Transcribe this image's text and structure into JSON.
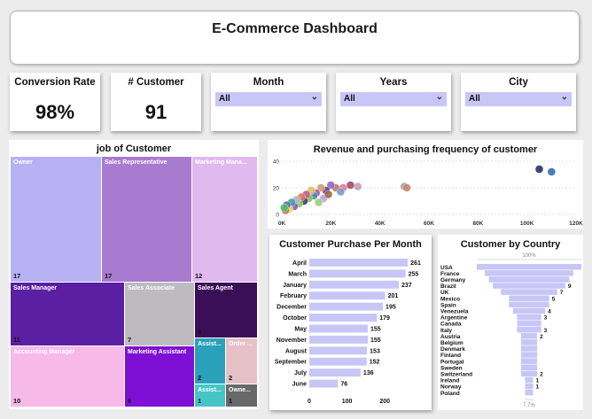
{
  "header": {
    "title": "E-Commerce Dashboard"
  },
  "kpis": [
    {
      "label": "Conversion Rate",
      "value": "98%"
    },
    {
      "label": "# Customer",
      "value": "91"
    }
  ],
  "slicers": [
    {
      "label": "Month",
      "value": "All"
    },
    {
      "label": "Years",
      "value": "All"
    },
    {
      "label": "City",
      "value": "All"
    }
  ],
  "treemap": {
    "title": "job of Customer",
    "cells": [
      {
        "name": "Owner",
        "count": "17",
        "color": "#b7b0f2"
      },
      {
        "name": "Sales Representative",
        "count": "17",
        "color": "#a87ad0"
      },
      {
        "name": "Marketing Mana...",
        "count": "12",
        "color": "#e0b9ee"
      },
      {
        "name": "Sales Manager",
        "count": "11",
        "color": "#5a1fa3"
      },
      {
        "name": "Sales Associate",
        "count": "7",
        "color": "#bdbac0"
      },
      {
        "name": "Sales Agent",
        "count": "6",
        "color": "#3a0f57"
      },
      {
        "name": "Accounting Manager",
        "count": "10",
        "color": "#f6b9e8"
      },
      {
        "name": "Marketing Assistant",
        "count": "6",
        "color": "#7d10d4"
      },
      {
        "name": "Assist...",
        "count": "2",
        "color": "#2aa0ba"
      },
      {
        "name": "Order ...",
        "count": "2",
        "color": "#e5c0c7"
      },
      {
        "name": "Assist...",
        "count": "1",
        "color": "#46c5c7"
      },
      {
        "name": "Owne...",
        "count": "1",
        "color": "#686868"
      }
    ]
  },
  "chart_data": [
    {
      "type": "scatter",
      "title": "Revenue and purchasing frequency of customer",
      "xlabel": "",
      "ylabel": "",
      "xlim": [
        0,
        120000
      ],
      "ylim": [
        0,
        40
      ],
      "x_ticks": [
        "0K",
        "20K",
        "40K",
        "60K",
        "80K",
        "100K",
        "120K"
      ],
      "y_ticks": [
        "0",
        "20",
        "40"
      ],
      "points": [
        {
          "x": 105000,
          "y": 34,
          "color": "#2b2f6b"
        },
        {
          "x": 110000,
          "y": 32,
          "color": "#3a6fb0"
        },
        {
          "x": 50000,
          "y": 21,
          "color": "#9aa0a8"
        },
        {
          "x": 51000,
          "y": 20,
          "color": "#c98b6a"
        },
        {
          "x": 31000,
          "y": 21,
          "color": "#c9a0b8"
        },
        {
          "x": 28000,
          "y": 22,
          "color": "#a0506a"
        },
        {
          "x": 25000,
          "y": 20,
          "color": "#e07aa0"
        },
        {
          "x": 22000,
          "y": 20,
          "color": "#c87a5a"
        },
        {
          "x": 20000,
          "y": 22,
          "color": "#8a6ad0"
        },
        {
          "x": 18000,
          "y": 18,
          "color": "#6a3a9a"
        },
        {
          "x": 16000,
          "y": 20,
          "color": "#d0a070"
        },
        {
          "x": 14000,
          "y": 16,
          "color": "#a05ab0"
        },
        {
          "x": 13000,
          "y": 14,
          "color": "#4a8ac0"
        },
        {
          "x": 12000,
          "y": 18,
          "color": "#e0c060"
        },
        {
          "x": 11000,
          "y": 12,
          "color": "#8ac04a"
        },
        {
          "x": 10000,
          "y": 15,
          "color": "#c05a8a"
        },
        {
          "x": 9000,
          "y": 10,
          "color": "#3a3a8a"
        },
        {
          "x": 8000,
          "y": 13,
          "color": "#e07a4a"
        },
        {
          "x": 7000,
          "y": 8,
          "color": "#7ad04a"
        },
        {
          "x": 6000,
          "y": 11,
          "color": "#b0b0d0"
        },
        {
          "x": 5000,
          "y": 6,
          "color": "#9a4ad0"
        },
        {
          "x": 4000,
          "y": 9,
          "color": "#40a0a0"
        },
        {
          "x": 3000,
          "y": 4,
          "color": "#e0e040"
        },
        {
          "x": 2000,
          "y": 7,
          "color": "#6a6ab0"
        },
        {
          "x": 1500,
          "y": 3,
          "color": "#d06a6a"
        },
        {
          "x": 1000,
          "y": 5,
          "color": "#4ac06a"
        },
        {
          "x": 17000,
          "y": 12,
          "color": "#c0a0e0"
        },
        {
          "x": 19000,
          "y": 15,
          "color": "#a06a4a"
        },
        {
          "x": 24000,
          "y": 17,
          "color": "#7a9ad0"
        },
        {
          "x": 15000,
          "y": 9,
          "color": "#9ad07a"
        }
      ]
    },
    {
      "type": "bar",
      "orientation": "horizontal",
      "title": "Customer Purchase Per Month",
      "categories": [
        "April",
        "March",
        "January",
        "February",
        "December",
        "October",
        "May",
        "November",
        "August",
        "September",
        "July",
        "June"
      ],
      "values": [
        261,
        255,
        237,
        201,
        195,
        179,
        155,
        155,
        153,
        152,
        136,
        76
      ],
      "x_ticks": [
        "0",
        "100",
        "200"
      ],
      "xlim": [
        0,
        270
      ],
      "color": "#c8c6f6"
    },
    {
      "type": "bar",
      "orientation": "funnel",
      "title": "Customer by Country",
      "categories": [
        "USA",
        "France",
        "Germany",
        "Brazil",
        "UK",
        "Mexico",
        "Spain",
        "Venezuela",
        "Argentine",
        "Canada",
        "Italy",
        "Austria",
        "Belgium",
        "Denmark",
        "Finland",
        "Portugal",
        "Sweden",
        "Switzerland",
        "Ireland",
        "Norway",
        "Poland"
      ],
      "values": [
        13,
        11,
        10,
        9,
        7,
        5,
        5,
        4,
        3,
        3,
        3,
        2,
        2,
        2,
        2,
        2,
        2,
        2,
        1,
        1,
        1
      ],
      "labels": [
        "",
        "",
        "",
        "9",
        "7",
        "5",
        "",
        "4",
        "3",
        "",
        "3",
        "2",
        "",
        "",
        "",
        "",
        "",
        "2",
        "1",
        "1",
        ""
      ],
      "top_pct": "100%",
      "bottom_pct": "7.7%",
      "color": "#c8c6f6"
    }
  ]
}
